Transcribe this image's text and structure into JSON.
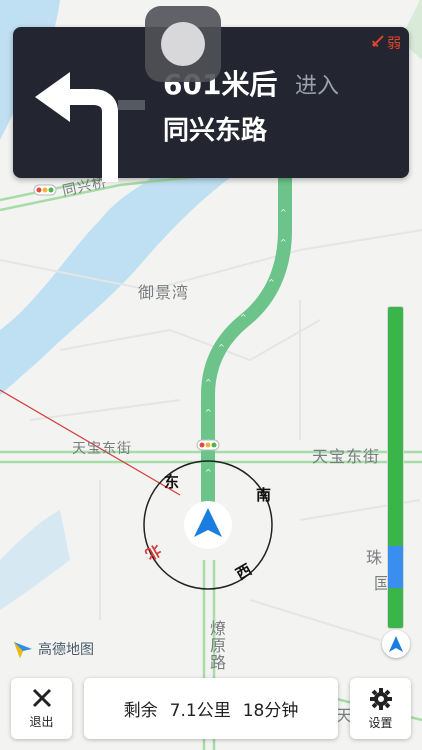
{
  "guidance": {
    "distance": "601米后",
    "action": "进入",
    "road_name": "同兴东路",
    "turn_icon": "turn-left-arrow-icon",
    "signal_text": "弱",
    "signal_icon": "gps-signal-icon"
  },
  "map": {
    "labels": {
      "poi_yujingwan": "御景湾",
      "street_tianbao_west": "天宝东街",
      "street_tianbao_east": "天宝东街",
      "street_tianbao_bottom": "天宝东街",
      "road_tongxing": "同兴桥",
      "road_liaoyuan": "燎原路",
      "partial_right_1": "珠",
      "partial_right_2": "国"
    },
    "compass": {
      "east": "东",
      "south": "南",
      "west": "西",
      "north": "北"
    },
    "logo_text": "高德地图"
  },
  "progress": {
    "remaining_congestion_fraction": 0.14
  },
  "bottom": {
    "exit_label": "退出",
    "remaining_prefix": "剩余",
    "remaining_distance": "7.1公里",
    "remaining_time": "18分钟",
    "settings_label": "设置"
  },
  "colors": {
    "panel": "#232630",
    "route": "#6cc48a",
    "traffic_green": "#3ab54a",
    "traffic_blue": "#3a8ef0",
    "water": "#bfe0f2",
    "nav_arrow": "#1a7de0"
  }
}
